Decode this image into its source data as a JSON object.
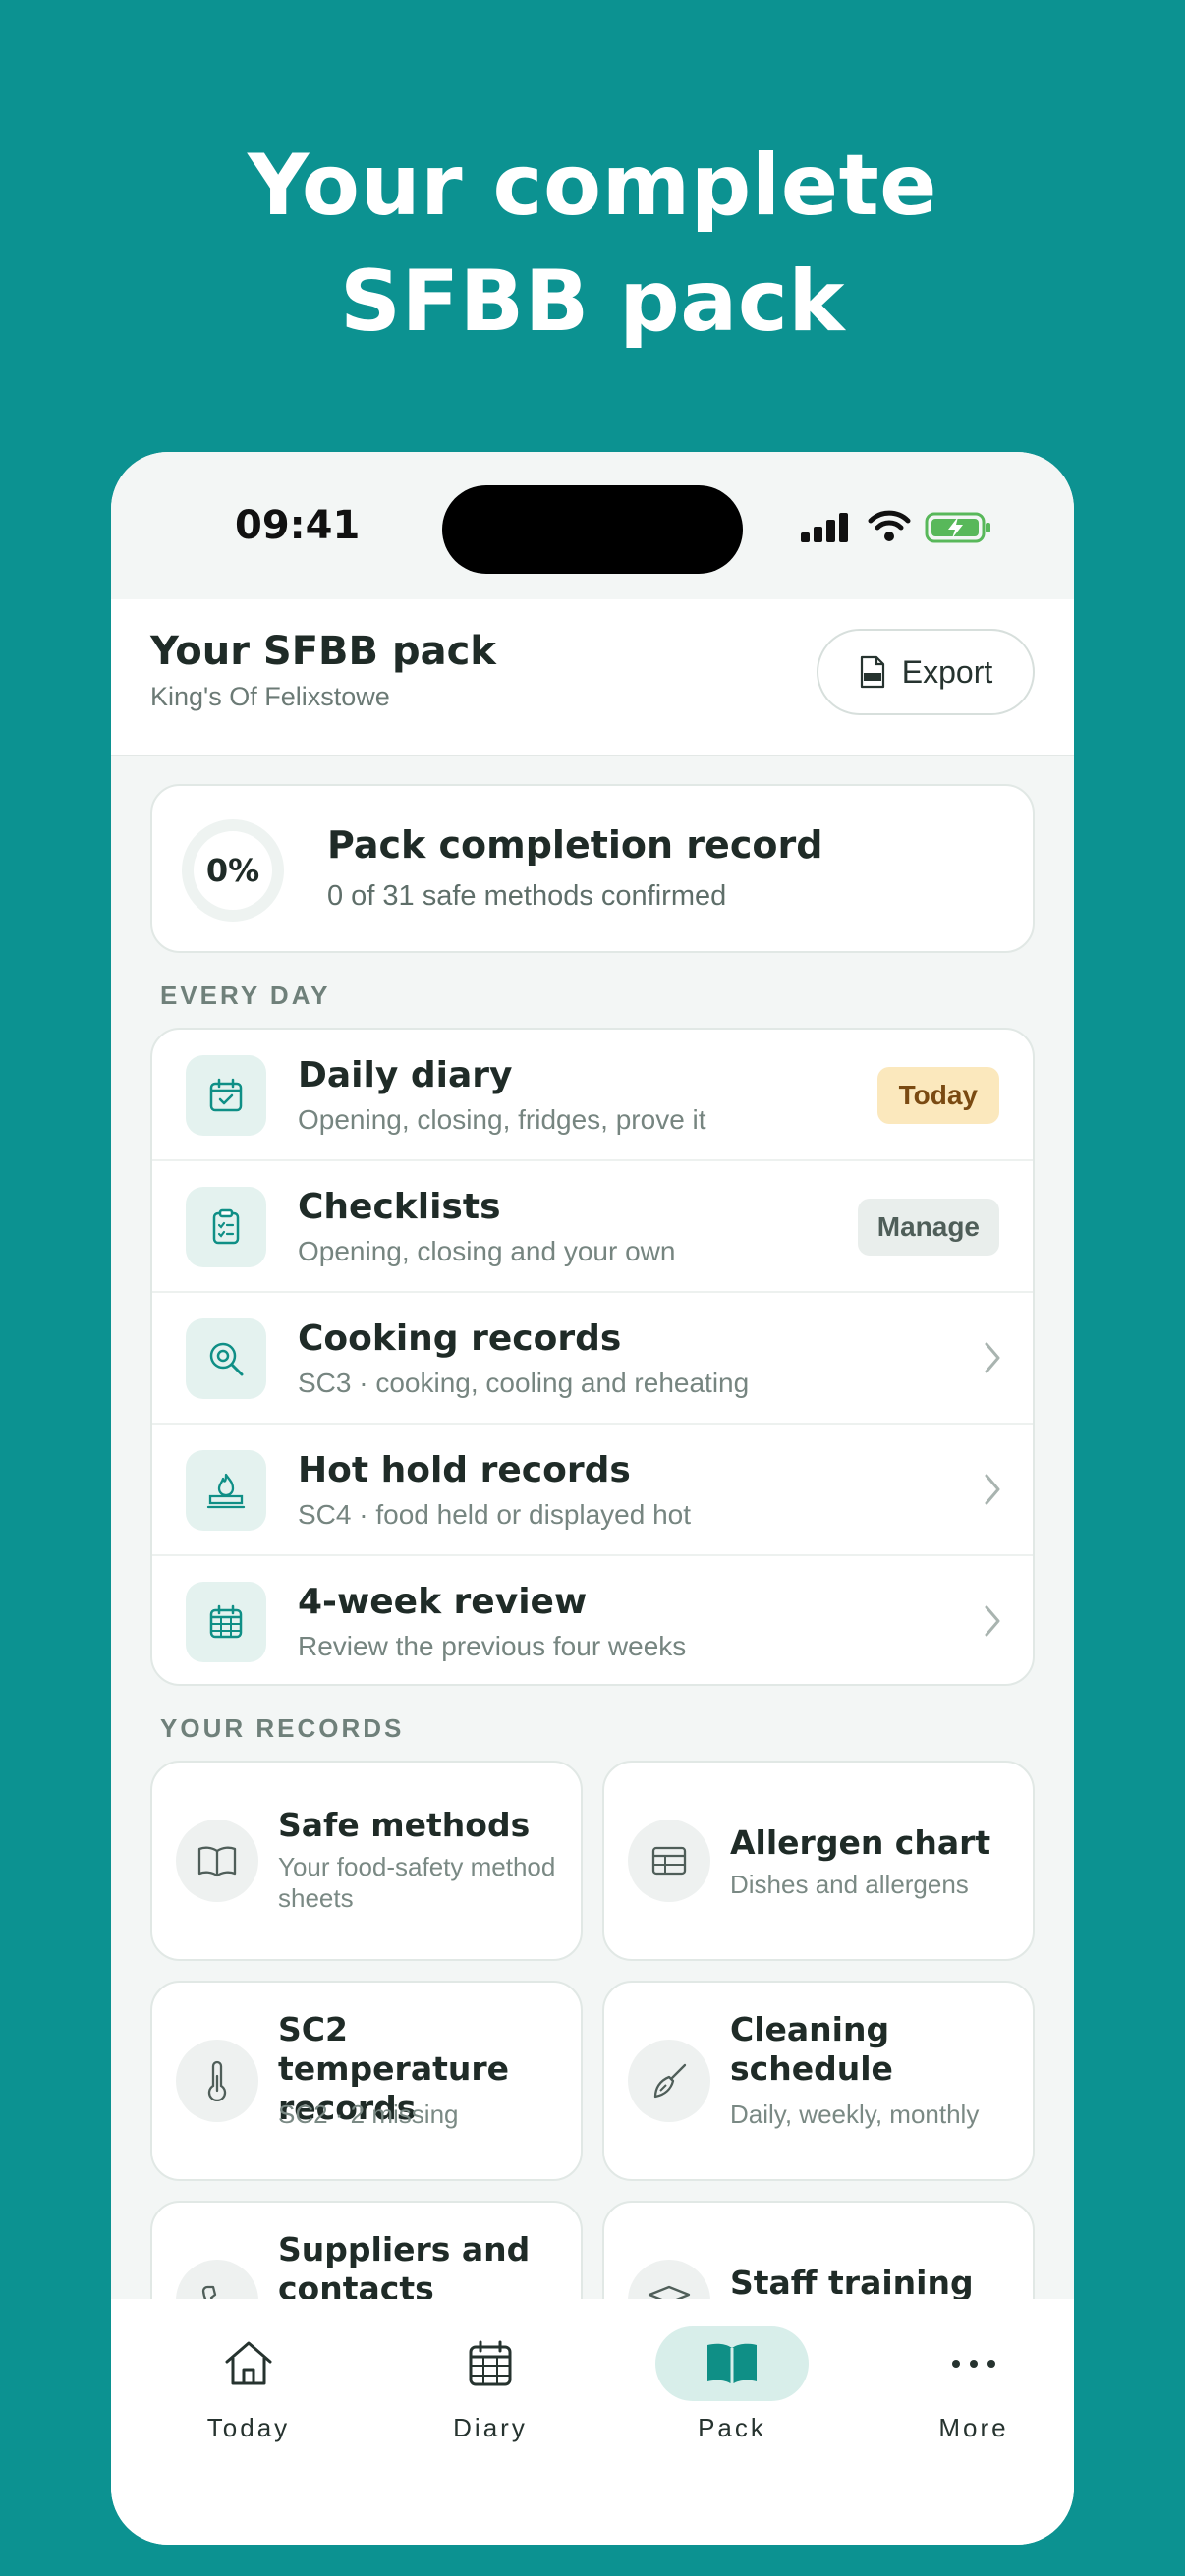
{
  "hero": {
    "line1": "Your complete",
    "line2": "SFBB pack"
  },
  "status_bar": {
    "time": "09:41"
  },
  "header": {
    "title": "Your SFBB pack",
    "subtitle": "King's Of Felixstowe",
    "export_label": "Export"
  },
  "completion": {
    "percent_label": "0%",
    "title": "Pack completion record",
    "subtitle": "0 of 31 safe methods confirmed",
    "progress": 0
  },
  "every_day": {
    "label": "EVERY DAY",
    "items": [
      {
        "title": "Daily diary",
        "subtitle": "Opening, closing, fridges, prove it",
        "badge": "Today"
      },
      {
        "title": "Checklists",
        "subtitle": "Opening, closing and your own",
        "badge": "Manage"
      },
      {
        "title": "Cooking records",
        "subtitle": "SC3 · cooking, cooling and reheating"
      },
      {
        "title": "Hot hold records",
        "subtitle": "SC4 · food held or displayed hot"
      },
      {
        "title": "4-week review",
        "subtitle": "Review the previous four weeks"
      }
    ]
  },
  "your_records": {
    "label": "YOUR RECORDS",
    "tiles": [
      {
        "title": "Safe methods",
        "subtitle": "Your food-safety method sheets"
      },
      {
        "title": "Allergen chart",
        "subtitle": "Dishes and allergens"
      },
      {
        "title": "SC2 temperature records",
        "subtitle": "SC2 · 2 missing"
      },
      {
        "title": "Cleaning schedule",
        "subtitle": "Daily, weekly, monthly"
      },
      {
        "title": "Suppliers and contacts",
        "subtitle": ""
      },
      {
        "title": "Staff training",
        "subtitle": ""
      }
    ]
  },
  "tabbar": {
    "tabs": [
      {
        "label": "Today"
      },
      {
        "label": "Diary"
      },
      {
        "label": "Pack"
      },
      {
        "label": "More"
      }
    ],
    "active": "Pack"
  },
  "colors": {
    "background": "#0c9291",
    "accent": "#0f8f86",
    "today_badge": "#fbe8bd"
  }
}
